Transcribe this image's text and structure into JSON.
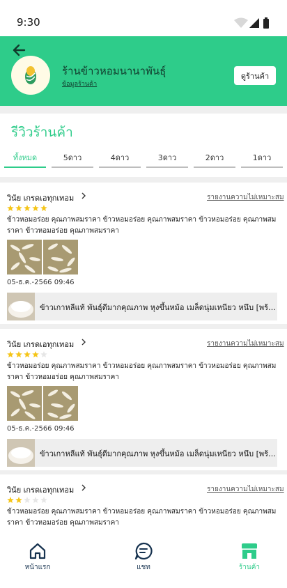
{
  "status_bar": {
    "time": "9:30"
  },
  "header": {
    "shop_name": "ร้านข้าวหอมนานาพันธุ์",
    "shop_info_link": "ข้อมูลร้านค้า",
    "visit_shop_button": "ดูร้านค้า"
  },
  "page": {
    "title": "รีวิวร้านค้า",
    "tabs": [
      {
        "label": "ทั้งหมด",
        "active": true
      },
      {
        "label": "5ดาว",
        "active": false
      },
      {
        "label": "4ดาว",
        "active": false
      },
      {
        "label": "3ดาว",
        "active": false
      },
      {
        "label": "2ดาว",
        "active": false
      },
      {
        "label": "1ดาว",
        "active": false
      }
    ]
  },
  "reviews": [
    {
      "user": "วินัย เกรดเอทุกเทอม",
      "report_link": "รายงานความไม่เหมาะสม",
      "rating": 5,
      "text": "ข้าวหอมอร่อย คุณภาพสมราคา ข้าวหอมอร่อย คุณภาพสมราคา ข้าวหอมอร่อย คุณภาพสมราคา ข้าวหอมอร่อย คุณภาพสมราคา",
      "date": "05-ธ.ค.-2566  09:46",
      "product_name": "ข้าวเกาหลีแท้ พันธุ์ดีมากคุณภาพ หุงขึ้นหม้อ  เมล็ดนุ่มเหนียว หนึบ [พร้อมส่ง]"
    },
    {
      "user": "วินัย เกรดเอทุกเทอม",
      "report_link": "รายงานความไม่เหมาะสม",
      "rating": 4,
      "text": "ข้าวหอมอร่อย คุณภาพสมราคา ข้าวหอมอร่อย คุณภาพสมราคา ข้าวหอมอร่อย คุณภาพสมราคา ข้าวหอมอร่อย คุณภาพสมราคา",
      "date": "05-ธ.ค.-2566  09:46",
      "product_name": "ข้าวเกาหลีแท้ พันธุ์ดีมากคุณภาพ หุงขึ้นหม้อ  เมล็ดนุ่มเหนียว หนึบ [พร้อมส่ง]"
    },
    {
      "user": "วินัย เกรดเอทุกเทอม",
      "report_link": "รายงานความไม่เหมาะสม",
      "rating": 2,
      "text": "ข้าวหอมอร่อย คุณภาพสมราคา ข้าวหอมอร่อย คุณภาพสมราคา ข้าวหอมอร่อย คุณภาพสมราคา ข้าวหอมอร่อย คุณภาพสมราคา"
    }
  ],
  "bottom_nav": [
    {
      "label": "หน้าแรก",
      "icon": "home-icon",
      "active": false
    },
    {
      "label": "แชท",
      "icon": "chat-icon",
      "active": false
    },
    {
      "label": "ร้านค้า",
      "icon": "store-icon",
      "active": true
    }
  ],
  "colors": {
    "brand_green": "#2ecc8a",
    "star_gold": "#f5c518",
    "nav_dark": "#16324f"
  }
}
